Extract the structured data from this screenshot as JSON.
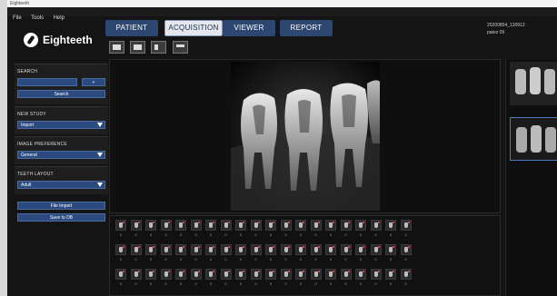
{
  "window": {
    "title": "Eighteeth"
  },
  "menu": [
    "File",
    "Tools",
    "Help"
  ],
  "brand": {
    "name": "Eighteeth"
  },
  "tabs": [
    "PATIENT",
    "ACQUISITION",
    "VIEWER",
    "REPORT"
  ],
  "active_tab": "ACQUISITION",
  "session": {
    "timestamp": "20200804_130912",
    "patient": "patez 09"
  },
  "toolbar": {
    "icons": [
      "capture-icon",
      "import-icon",
      "split-view-icon",
      "layout-icon"
    ]
  },
  "sidebar": {
    "search": {
      "label": "SEARCH",
      "value": "",
      "add_label": "+",
      "button_label": "Search"
    },
    "new_study": {
      "label": "NEW STUDY",
      "value": "Import"
    },
    "image_preference": {
      "label": "IMAGE PREFERENCE",
      "value": "General"
    },
    "teeth_layout": {
      "label": "TEETH LAYOUT",
      "value": "Adult"
    },
    "file_import_label": "File Import",
    "save_label": "Save to DB"
  },
  "tooth_grid": {
    "rows": [
      [
        "0",
        "0",
        "0",
        "0",
        "0",
        "0",
        "0",
        "0",
        "0",
        "0",
        "0",
        "0",
        "0",
        "0",
        "0",
        "0",
        "0",
        "0",
        "0",
        "0"
      ],
      [
        "0",
        "0",
        "0",
        "0",
        "0",
        "0",
        "0",
        "0",
        "0",
        "0",
        "0",
        "0",
        "0",
        "0",
        "0",
        "0",
        "0",
        "0",
        "0",
        "0"
      ],
      [
        "0",
        "0",
        "0",
        "0",
        "0",
        "0",
        "0",
        "0",
        "0",
        "0",
        "0",
        "0",
        "0",
        "0",
        "0",
        "0",
        "0",
        "0",
        "0",
        "0"
      ]
    ]
  }
}
